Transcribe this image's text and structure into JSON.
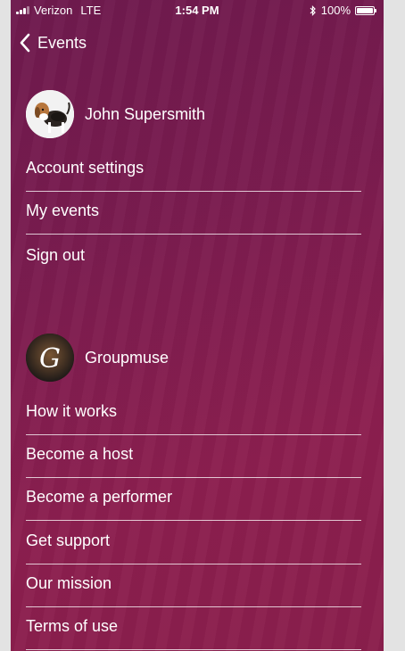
{
  "status_bar": {
    "carrier": "Verizon",
    "network": "LTE",
    "time": "1:54 PM",
    "battery": "100%"
  },
  "nav": {
    "back_label": "Events"
  },
  "account": {
    "user_name": "John Supersmith",
    "items": [
      {
        "label": "Account settings"
      },
      {
        "label": "My events"
      },
      {
        "label": "Sign out"
      }
    ]
  },
  "org": {
    "name": "Groupmuse",
    "logo_letter": "G",
    "items": [
      {
        "label": "How it works"
      },
      {
        "label": "Become a host"
      },
      {
        "label": "Become a performer"
      },
      {
        "label": "Get support"
      },
      {
        "label": "Our mission"
      },
      {
        "label": "Terms of use"
      }
    ]
  }
}
